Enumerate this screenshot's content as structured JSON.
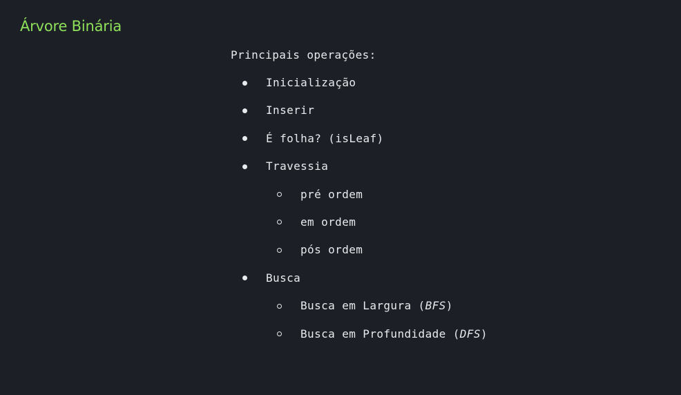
{
  "slide": {
    "title": "Árvore Binária",
    "intro": "Principais operações:",
    "operations": [
      {
        "label": "Inicialização"
      },
      {
        "label": "Inserir"
      },
      {
        "label": "É folha? (isLeaf)"
      },
      {
        "label": "Travessia",
        "children": [
          {
            "label": "pré ordem"
          },
          {
            "label": "em ordem"
          },
          {
            "label": "pós ordem"
          }
        ]
      },
      {
        "label": "Busca",
        "children": [
          {
            "prefix": "Busca em Largura (",
            "abbr": "BFS",
            "suffix": ")"
          },
          {
            "prefix": "Busca em Profundidade (",
            "abbr": "DFS",
            "suffix": ")"
          }
        ]
      }
    ]
  },
  "colors": {
    "background": "#1c2026",
    "title": "#8ee05a",
    "text": "#e8eaed"
  },
  "icons": {
    "level_1_bullet": "filled-disc",
    "level_2_bullet": "hollow-circle"
  }
}
